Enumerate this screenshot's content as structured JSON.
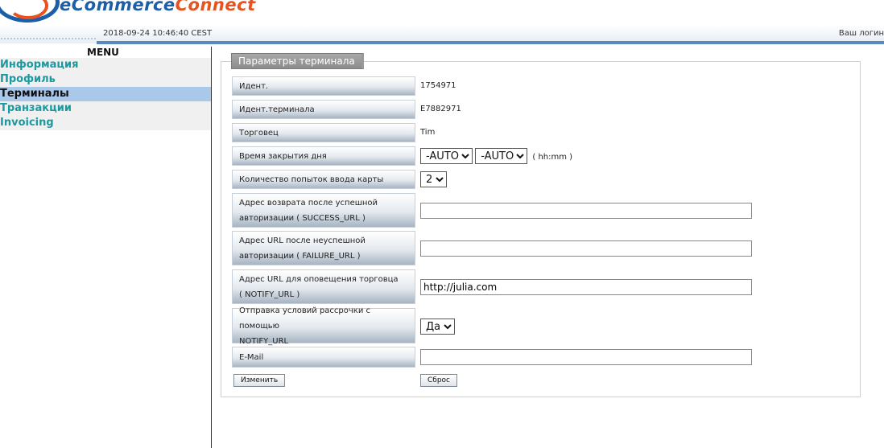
{
  "header": {
    "brand_part1": "eCommerce",
    "brand_part2": "Connect",
    "datetime": "2018-09-24 10:46:40 CEST",
    "login_text": "Ваш логин"
  },
  "menu": {
    "title": "MENU",
    "items": [
      {
        "label": "Информация",
        "active": false
      },
      {
        "label": "Профиль",
        "active": false
      },
      {
        "label": "Терминалы",
        "active": true
      },
      {
        "label": "Транзакции",
        "active": false
      },
      {
        "label": "Invoicing",
        "active": false
      }
    ]
  },
  "panel": {
    "legend": "Параметры терминала",
    "fields": {
      "id_label": "Идент.",
      "id_value": "1754971",
      "terminal_id_label": "Идент.терминала",
      "terminal_id_value": "E7882971",
      "merchant_label": "Торговец",
      "merchant_value": "Tim",
      "day_close_label": "Время закрытия дня",
      "day_close_hours": "-AUTO",
      "day_close_minutes": "-AUTO",
      "day_close_hint": "( hh:mm )",
      "card_attempts_label": "Количество попыток ввода карты",
      "card_attempts_value": "2",
      "success_url_label_1": "Адрес возврата после успешной",
      "success_url_label_2": "авторизации ( SUCCESS_URL )",
      "success_url_value": "",
      "failure_url_label_1": "Адрес URL после неуспешной",
      "failure_url_label_2": "авторизации ( FAILURE_URL )",
      "failure_url_value": "",
      "notify_url_label_1": "Адрес URL для оповещения торговца",
      "notify_url_label_2": "( NOTIFY_URL )",
      "notify_url_value": "http://julia.com",
      "installments_label_1": "Отправка условий рассрочки с помощью",
      "installments_label_2": "NOTIFY_URL",
      "installments_value": "Да",
      "email_label": "E-Mail",
      "email_value": ""
    },
    "buttons": {
      "change": "Изменить",
      "reset": "Сброс"
    }
  },
  "colors": {
    "brand_blue": "#1c5fa8",
    "brand_orange": "#e8521f",
    "menu_link": "#1a9aa0",
    "menu_active_bg": "#a9c8ea"
  }
}
